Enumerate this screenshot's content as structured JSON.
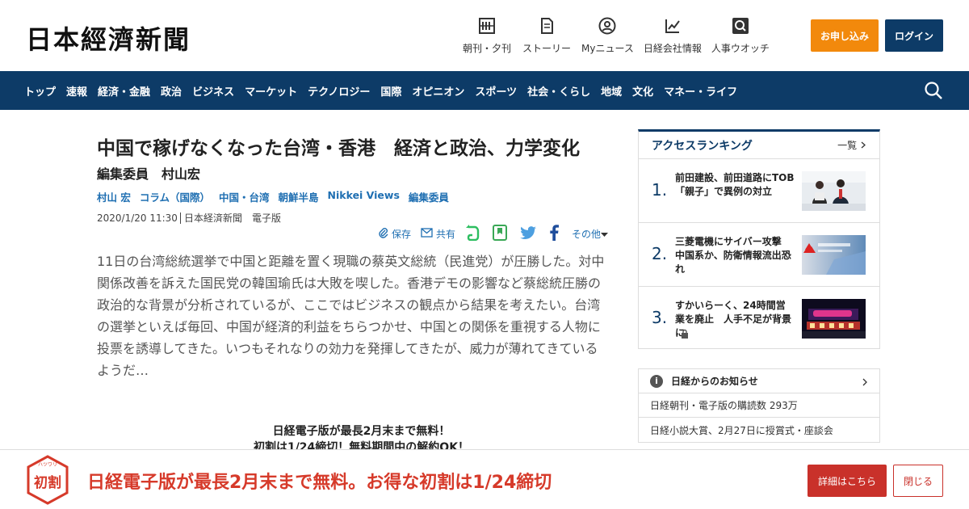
{
  "header": {
    "logo": "日本經濟新聞",
    "nav": [
      {
        "label": "朝刊・夕刊",
        "icon": "newspaper-icon"
      },
      {
        "label": "ストーリー",
        "icon": "document-icon"
      },
      {
        "label": "Myニュース",
        "icon": "user-icon"
      },
      {
        "label": "日経会社情報",
        "icon": "chart-icon"
      },
      {
        "label": "人事ウオッチ",
        "icon": "magnifier-icon"
      }
    ],
    "apply_label": "お申し込み",
    "login_label": "ログイン",
    "apply_color": "#f2890c",
    "brand_color": "#0d3b67"
  },
  "navbar": {
    "items": [
      "トップ",
      "速報",
      "経済・金融",
      "政治",
      "ビジネス",
      "マーケット",
      "テクノロジー",
      "国際",
      "オピニオン",
      "スポーツ",
      "社会・くらし",
      "地域",
      "文化",
      "マネー・ライフ"
    ]
  },
  "article": {
    "title": "中国で稼げなくなった台湾・香港　経済と政治、力学変化",
    "subtitle": "編集委員　村山宏",
    "tags": [
      "村山 宏",
      "コラム（国際）",
      "中国・台湾",
      "朝鮮半島",
      "Nikkei Views",
      "編集委員"
    ],
    "date": "2020/1/20 11:30",
    "source": "日本経済新聞　電子版",
    "share": {
      "save": "保存",
      "share": "共有",
      "more": "その他"
    },
    "body": "11日の台湾総統選挙で中国と距離を置く現職の蔡英文総統（民進党）が圧勝した。対中関係改善を訴えた国民党の韓国瑜氏は大敗を喫した。香港デモの影響など蔡総統圧勝の政治的な背景が分析されているが、ここではビジネスの観点から結果を考えたい。台湾の選挙といえば毎回、中国が経済的利益をちらつかせ、中国との関係を重視する人物に投票を誘導してきた。いつもそれなりの効力を発揮してきたが、威力が薄れてきているようだ…",
    "promo_line1": "日経電子版が最長2月末まで無料！",
    "promo_line2": "初割は1/24締切！無料期間中の解約OK！"
  },
  "ranking": {
    "title": "アクセスランキング",
    "all_label": "一覧",
    "items": [
      {
        "rank": "1.",
        "text": "前田建設、前田道路にTOB　「親子」で異例の対立"
      },
      {
        "rank": "2.",
        "text": "三菱電機にサイバー攻撃　中国系か、防衛情報流出恐れ"
      },
      {
        "rank": "3.",
        "text": "すかいらーく、24時間営業を廃止　人手不足が背景に"
      }
    ]
  },
  "notices": {
    "title": "日経からのお知らせ",
    "items": [
      "日経朝刊・電子版の購読数 293万",
      "日経小説大賞、2月27日に授賞式・座談会"
    ]
  },
  "banner": {
    "logo_ruby": "ハツワリ",
    "logo_text": "初割",
    "text": "日経電子版が最長2月末まで無料。お得な初割は1/24締切",
    "detail_label": "詳細はこちら",
    "close_label": "閉じる",
    "accent_color": "#d63a2a"
  }
}
